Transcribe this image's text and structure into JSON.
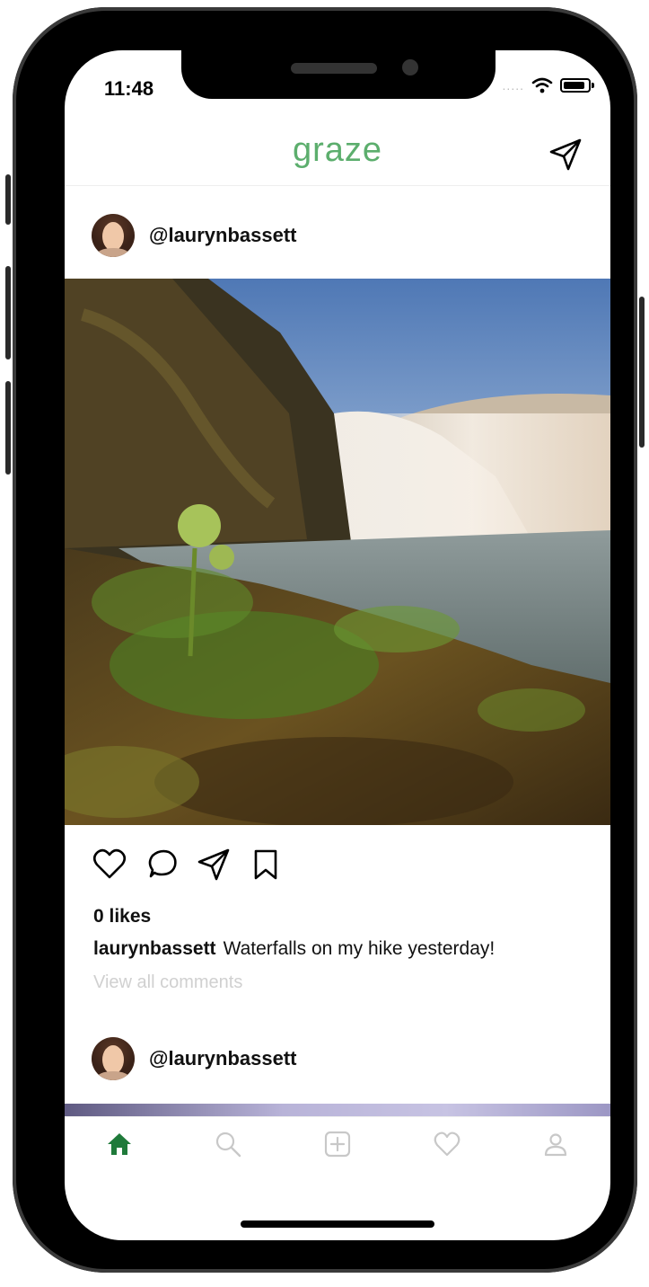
{
  "status_bar": {
    "time": "11:48",
    "signal": ".....",
    "battery_level": 0.9
  },
  "header": {
    "title": "graze"
  },
  "posts": [
    {
      "username": "@laurynbassett",
      "likes": "0 likes",
      "caption_user": "laurynbassett",
      "caption_text": "Waterfalls on my hike yesterday!",
      "view_all": "View all  comments"
    },
    {
      "username": "@laurynbassett"
    }
  ],
  "colors": {
    "brand": "#5cae6d",
    "active_tab": "#1f7a3a",
    "inactive_tab": "#c8c8c8"
  },
  "tabs": [
    {
      "icon": "home-icon",
      "active": true
    },
    {
      "icon": "search-icon",
      "active": false
    },
    {
      "icon": "add-post-icon",
      "active": false
    },
    {
      "icon": "heart-icon",
      "active": false
    },
    {
      "icon": "profile-icon",
      "active": false
    }
  ]
}
